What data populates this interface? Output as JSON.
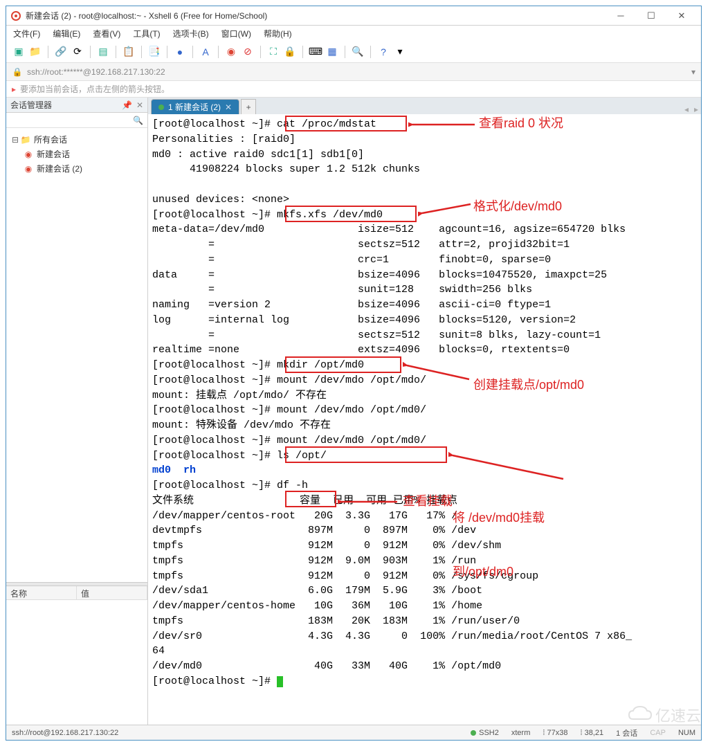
{
  "title": "新建会话 (2) - root@localhost:~ - Xshell 6 (Free for Home/School)",
  "menu": [
    "文件(F)",
    "编辑(E)",
    "查看(V)",
    "工具(T)",
    "选项卡(B)",
    "窗口(W)",
    "帮助(H)"
  ],
  "address": "ssh://root:******@192.168.217.130:22",
  "hint": "要添加当前会话，点击左侧的箭头按钮。",
  "sidebar": {
    "title": "会话管理器",
    "root": "所有会话",
    "items": [
      "新建会话",
      "新建会话 (2)"
    ],
    "prop_cols": [
      "名称",
      "值"
    ]
  },
  "tab": {
    "label": "1 新建会话 (2)"
  },
  "terminal_text": "[root@localhost ~]# cat /proc/mdstat\nPersonalities : [raid0]\nmd0 : active raid0 sdc1[1] sdb1[0]\n      41908224 blocks super 1.2 512k chunks\n\nunused devices: <none>\n[root@localhost ~]# mkfs.xfs /dev/md0\nmeta-data=/dev/md0               isize=512    agcount=16, agsize=654720 blks\n         =                       sectsz=512   attr=2, projid32bit=1\n         =                       crc=1        finobt=0, sparse=0\ndata     =                       bsize=4096   blocks=10475520, imaxpct=25\n         =                       sunit=128    swidth=256 blks\nnaming   =version 2              bsize=4096   ascii-ci=0 ftype=1\nlog      =internal log           bsize=4096   blocks=5120, version=2\n         =                       sectsz=512   sunit=8 blks, lazy-count=1\nrealtime =none                   extsz=4096   blocks=0, rtextents=0\n[root@localhost ~]# mkdir /opt/md0\n[root@localhost ~]# mount /dev/mdo /opt/mdo/\nmount: 挂载点 /opt/mdo/ 不存在\n[root@localhost ~]# mount /dev/mdo /opt/md0/\nmount: 特殊设备 /dev/mdo 不存在\n[root@localhost ~]# mount /dev/md0 /opt/md0/\n[root@localhost ~]# ls /opt/\n",
  "terminal_ls_line": "md0  rh",
  "terminal_text2": "[root@localhost ~]# df -h\n文件系统                 容量  已用  可用 已用% 挂载点\n/dev/mapper/centos-root   20G  3.3G   17G   17% /\ndevtmpfs                 897M     0  897M    0% /dev\ntmpfs                    912M     0  912M    0% /dev/shm\ntmpfs                    912M  9.0M  903M    1% /run\ntmpfs                    912M     0  912M    0% /sys/fs/cgroup\n/dev/sda1                6.0G  179M  5.9G    3% /boot\n/dev/mapper/centos-home   10G   36M   10G    1% /home\ntmpfs                    183M   20K  183M    1% /run/user/0\n/dev/sr0                 4.3G  4.3G     0  100% /run/media/root/CentOS 7 x86_\n64\n/dev/md0                  40G   33M   40G    1% /opt/md0\n[root@localhost ~]# ",
  "annotations": {
    "a1": "查看raid 0 状况",
    "a2": "格式化/dev/md0",
    "a3": "创建挂载点/opt/md0",
    "a4_l1": "将 /dev/md0挂载",
    "a4_l2": "到/opt/dm0",
    "a5": "查看挂载"
  },
  "status": {
    "left": "ssh://root@192.168.217.130:22",
    "ssh": "SSH2",
    "term": "xterm",
    "size": "77x38",
    "pos": "38,21",
    "sess": "1 会话",
    "cap": "CAP",
    "num": "NUM"
  },
  "watermark": "亿速云"
}
